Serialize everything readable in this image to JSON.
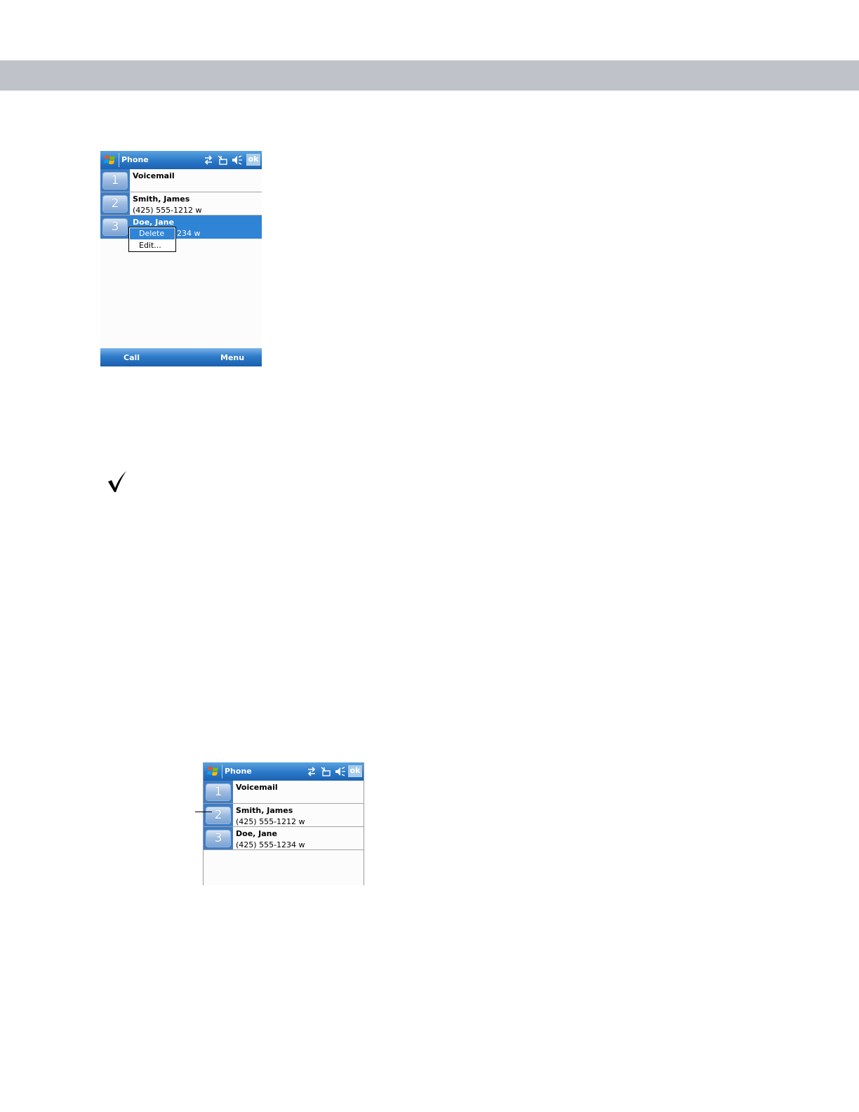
{
  "screen1": {
    "title": "Phone",
    "ok_label": "ok",
    "entries": [
      {
        "key": "1",
        "name": "Voicemail",
        "phone": ""
      },
      {
        "key": "2",
        "name": "Smith, James",
        "phone": "(425) 555-1212 w"
      },
      {
        "key": "3",
        "name": "Doe, Jane",
        "phone": "234 w"
      }
    ],
    "context_menu": {
      "items": [
        "Delete",
        "Edit..."
      ]
    },
    "menubar": {
      "left_label": "Call",
      "right_label": "Menu"
    }
  },
  "screen2": {
    "title": "Phone",
    "ok_label": "ok",
    "entries": [
      {
        "key": "1",
        "name": "Voicemail",
        "phone": ""
      },
      {
        "key": "2",
        "name": "Smith, James",
        "phone": "(425) 555-1212 w"
      },
      {
        "key": "3",
        "name": "Doe, Jane",
        "phone": "(425) 555-1234 w"
      }
    ]
  },
  "colors": {
    "header_band": "#c0c2c9",
    "titlebar_blue": "#2a78c8",
    "selection_blue": "#2f84d6"
  },
  "icons": [
    "windows-start-icon",
    "connectivity-icon",
    "signal-off-icon",
    "speaker-icon",
    "checkmark-icon"
  ]
}
